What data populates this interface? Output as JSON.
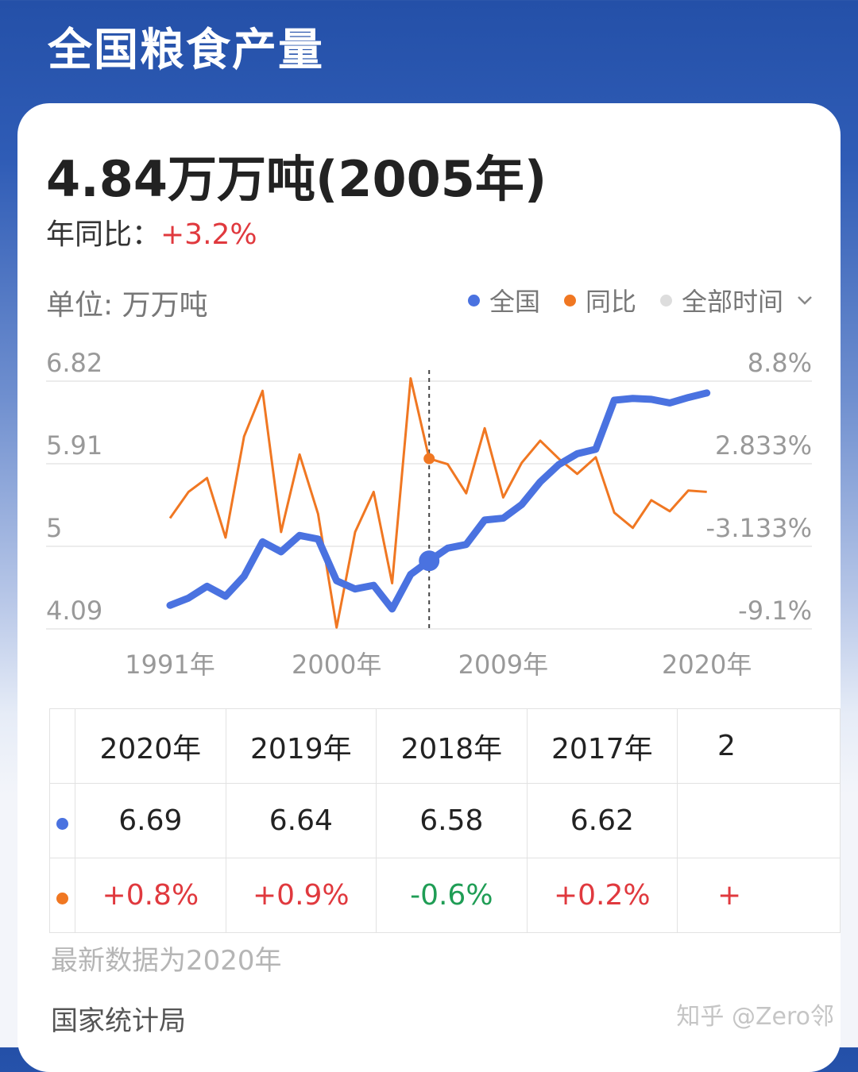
{
  "header": {
    "title": "全国粮食产量"
  },
  "summary": {
    "headline": "4.84万万吨(2005年)",
    "yoy_label": "年同比：",
    "yoy_value": "+3.2%"
  },
  "chart_header": {
    "unit_label": "单位: 万万吨",
    "legend": [
      {
        "label": "全国",
        "color": "#4a72e0"
      },
      {
        "label": "同比",
        "color": "#f07722"
      }
    ],
    "range_selector": {
      "label": "全部时间",
      "color": "#dddddd",
      "icon": "chevron-down-icon"
    }
  },
  "chart_data": {
    "type": "line",
    "x_start_label": "1991年",
    "x_tick_labels": [
      "1991年",
      "2000年",
      "2009年",
      "2020年"
    ],
    "left_axis_ticks": [
      "6.82",
      "5.91",
      "5",
      "4.09"
    ],
    "right_axis_ticks": [
      "8.8%",
      "2.833%",
      "-3.133%",
      "-9.1%"
    ],
    "left_ylim": [
      4.09,
      6.82
    ],
    "right_ylim": [
      -9.1,
      8.8
    ],
    "highlight_year": "2005年",
    "grid": true,
    "series": [
      {
        "name": "全国",
        "axis": "left",
        "color": "#4a72e0",
        "values": [
          4.35,
          4.43,
          4.56,
          4.45,
          4.67,
          5.05,
          4.94,
          5.12,
          5.08,
          4.62,
          4.53,
          4.57,
          4.31,
          4.69,
          4.84,
          4.98,
          5.02,
          5.29,
          5.31,
          5.46,
          5.71,
          5.9,
          6.02,
          6.07,
          6.61,
          6.63,
          6.62,
          6.58,
          6.64,
          6.69
        ]
      },
      {
        "name": "同比",
        "axis": "right",
        "color": "#f07722",
        "values": [
          -1.1,
          0.8,
          1.8,
          -2.5,
          4.8,
          8.1,
          -2.1,
          3.5,
          -0.8,
          -9.0,
          -2.1,
          0.8,
          -5.8,
          9.0,
          3.2,
          2.8,
          0.7,
          5.4,
          0.4,
          2.9,
          4.5,
          3.2,
          2.1,
          3.3,
          -0.7,
          -1.8,
          0.2,
          -0.6,
          0.9,
          0.8
        ]
      }
    ]
  },
  "table": {
    "headers": [
      "2020年",
      "2019年",
      "2018年",
      "2017年",
      "2"
    ],
    "production_row": [
      "6.69",
      "6.64",
      "6.58",
      "6.62",
      ""
    ],
    "yoy_row": [
      "+0.8%",
      "+0.9%",
      "-0.6%",
      "+0.2%",
      "+"
    ]
  },
  "footer": {
    "note": "最新数据为2020年",
    "source": "国家统计局",
    "watermark": "知乎 @Zero邻"
  }
}
